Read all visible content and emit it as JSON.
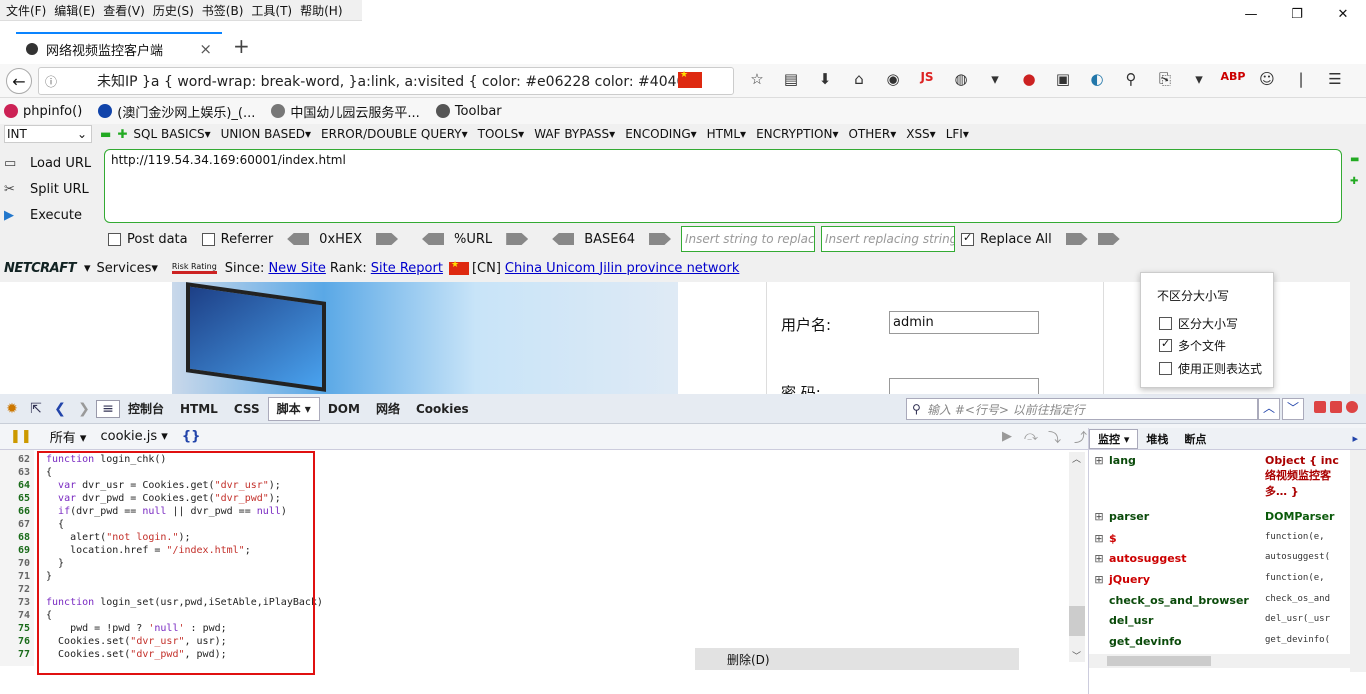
{
  "menubar": [
    "文件(F)",
    "编辑(E)",
    "查看(V)",
    "历史(S)",
    "书签(B)",
    "工具(T)",
    "帮助(H)"
  ],
  "window_controls": {
    "min": "—",
    "max": "❐",
    "close": "✕"
  },
  "tab": {
    "title": "网络视频监控客户端",
    "close": "×",
    "new": "+"
  },
  "urlbar": {
    "text": "未知IP   }a { word-wrap: break-word, }a:link, a:visited { color: #e06228 color: #404042",
    "flag_country": "CN"
  },
  "bookmarks": [
    {
      "label": "phpinfo()",
      "color": "#c25"
    },
    {
      "label": "(澳门金沙网上娱乐)_(...",
      "color": "#14a"
    },
    {
      "label": "中国幼儿园云服务平...",
      "color": "#777"
    },
    {
      "label": "Toolbar",
      "color": "#555"
    }
  ],
  "hackbar": {
    "int_select": "INT",
    "menus": [
      "SQL BASICS▾",
      "UNION BASED▾",
      "ERROR/DOUBLE QUERY▾",
      "TOOLS▾",
      "WAF BYPASS▾",
      "ENCODING▾",
      "HTML▾",
      "ENCRYPTION▾",
      "OTHER▾",
      "XSS▾",
      "LFI▾"
    ],
    "load_url": "Load URL",
    "split_url": "Split URL",
    "execute": "Execute",
    "url": "http://119.54.34.169:60001/index.html",
    "post_data": "Post data",
    "referrer": "Referrer",
    "hex": "0xHEX",
    "pct_url": "%URL",
    "base64": "BASE64",
    "insert_placeholder": "Insert string to replace",
    "replace_placeholder": "Insert replacing string",
    "replace_all": "Replace All"
  },
  "netcraft": {
    "logo": "NETCRAFT",
    "services": "Services▾",
    "risk": "Risk Rating",
    "since": "Since:",
    "new_site": "New Site",
    "rank": "Rank:",
    "site_report": "Site Report",
    "country": "[CN]",
    "network": "China Unicom Jilin province network"
  },
  "webpage": {
    "username_label": "用户名:",
    "username_value": "admin",
    "password_label": "密 码:"
  },
  "popup": {
    "title": "不区分大小写",
    "options": [
      {
        "label": "区分大小写",
        "checked": false
      },
      {
        "label": "多个文件",
        "checked": true
      },
      {
        "label": "使用正则表达式",
        "checked": false
      }
    ]
  },
  "firebug": {
    "tabs": [
      "控制台",
      "HTML",
      "CSS",
      "脚本 ▾",
      "DOM",
      "网络",
      "Cookies"
    ],
    "search_placeholder": "输入 #<行号> 以前往指定行",
    "filter": "所有 ▾",
    "file": "cookie.js ▾",
    "braces": "{}",
    "delete": "删除(D)",
    "right_tabs": [
      "监控 ▾",
      "堆栈",
      "断点"
    ]
  },
  "code_lines": [
    {
      "n": "62",
      "g": false,
      "t": "function login_chk()"
    },
    {
      "n": "63",
      "g": false,
      "t": "{"
    },
    {
      "n": "64",
      "g": true,
      "t": "  var dvr_usr = Cookies.get(\"dvr_usr\");"
    },
    {
      "n": "65",
      "g": true,
      "t": "  var dvr_pwd = Cookies.get(\"dvr_pwd\");"
    },
    {
      "n": "66",
      "g": true,
      "t": "  if(dvr_pwd == null || dvr_pwd == null)"
    },
    {
      "n": "67",
      "g": false,
      "t": "  {"
    },
    {
      "n": "68",
      "g": true,
      "t": "    alert(\"not login.\");"
    },
    {
      "n": "69",
      "g": true,
      "t": "    location.href = \"/index.html\";"
    },
    {
      "n": "70",
      "g": false,
      "t": "  }"
    },
    {
      "n": "71",
      "g": false,
      "t": "}"
    },
    {
      "n": "72",
      "g": false,
      "t": ""
    },
    {
      "n": "73",
      "g": false,
      "t": "function login_set(usr,pwd,iSetAble,iPlayBack)"
    },
    {
      "n": "74",
      "g": false,
      "t": "{"
    },
    {
      "n": "75",
      "g": true,
      "t": "    pwd = !pwd ? 'null' : pwd;"
    },
    {
      "n": "76",
      "g": true,
      "t": "  Cookies.set(\"dvr_usr\", usr);"
    },
    {
      "n": "77",
      "g": true,
      "t": "  Cookies.set(\"dvr_pwd\", pwd);"
    }
  ],
  "watch": [
    {
      "k": "lang",
      "red": false,
      "v": "Object { inc 络视频监控客 多… }",
      "bold": true
    },
    {
      "k": "parser",
      "red": false,
      "v": "DOMParser",
      "bold": true
    },
    {
      "k": "$",
      "red": true,
      "v": "function(e,",
      "bold": false
    },
    {
      "k": "autosuggest",
      "red": true,
      "v": "autosuggest(",
      "bold": false
    },
    {
      "k": "jQuery",
      "red": true,
      "v": "function(e,",
      "bold": false
    },
    {
      "k": "check_os_and_browser",
      "red": false,
      "v": "check_os_and",
      "bold": false
    },
    {
      "k": "del_usr",
      "red": false,
      "v": "del_usr(_usr",
      "bold": false
    },
    {
      "k": "get_devinfo",
      "red": false,
      "v": "get_devinfo(",
      "bold": false
    }
  ]
}
